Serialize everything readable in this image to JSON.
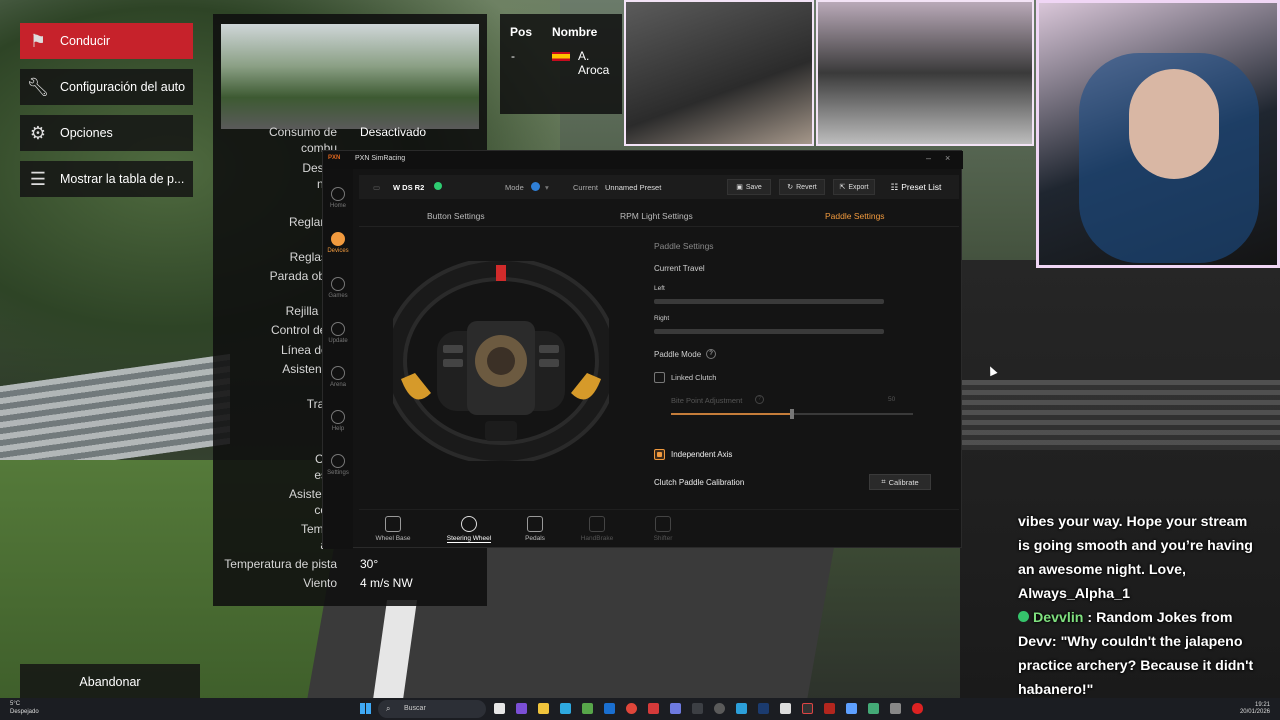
{
  "game_menu": {
    "items": [
      {
        "label": "Conducir",
        "icon": "checkered-flag-icon"
      },
      {
        "label": "Configuración del auto",
        "icon": "wrench-icon"
      },
      {
        "label": "Opciones",
        "icon": "gear-icon"
      },
      {
        "label": "Mostrar la tabla de p...",
        "icon": "list-icon"
      }
    ],
    "abandon_label": "Abandonar"
  },
  "session_settings": {
    "rows": [
      {
        "label": "Consumo de",
        "value": "Desactivado"
      },
      {
        "label": "combu",
        "value": ""
      },
      {
        "label": "Desga",
        "value": ""
      },
      {
        "label": "neu",
        "value": ""
      },
      {
        "label": "Reglame",
        "value": ""
      },
      {
        "label": "ba",
        "value": ""
      },
      {
        "label": "Reglas d",
        "value": ""
      },
      {
        "label": "Parada oblig",
        "value": ""
      },
      {
        "label": "Rejilla inv",
        "value": ""
      },
      {
        "label": "Control de tr",
        "value": ""
      },
      {
        "label": "Línea de c",
        "value": ""
      },
      {
        "label": "Asistencia",
        "value": ""
      },
      {
        "label": "Trans",
        "value": ""
      },
      {
        "label": "Fr",
        "value": ""
      },
      {
        "label": "Con",
        "value": ""
      },
      {
        "label": "esta",
        "value": ""
      },
      {
        "label": "Asistenci",
        "value": ""
      },
      {
        "label": "cont",
        "value": ""
      },
      {
        "label": "Tempe",
        "value": ""
      },
      {
        "label": "am",
        "value": ""
      },
      {
        "label": "Temperatura de pista",
        "value": "30°"
      },
      {
        "label": "Viento",
        "value": "4 m/s NW"
      }
    ]
  },
  "standings": {
    "headers": [
      "Pos",
      "Nombre"
    ],
    "rows": [
      {
        "pos": "-",
        "flag": "spain-flag-icon",
        "name": "A. Aroca"
      }
    ]
  },
  "pxn": {
    "window_title": "PXN SimRacing",
    "logo": "PXN",
    "sidebar": [
      {
        "label": "Home",
        "icon": "home-icon"
      },
      {
        "label": "Devices",
        "icon": "devices-icon",
        "active": true
      },
      {
        "label": "Games",
        "icon": "games-icon"
      },
      {
        "label": "Update",
        "icon": "update-icon"
      },
      {
        "label": "Arena",
        "icon": "arena-icon"
      },
      {
        "label": "Help",
        "icon": "help-icon"
      },
      {
        "label": "Settings",
        "icon": "settings-icon"
      }
    ],
    "device_name": "W DS R2",
    "mode_label": "Mode",
    "current_label": "Current",
    "preset_name": "Unnamed Preset",
    "buttons": {
      "save": "Save",
      "revert": "Revert",
      "export": "Export",
      "preset_list": "Preset List"
    },
    "tabs": [
      "Button Settings",
      "RPM Light Settings",
      "Paddle Settings"
    ],
    "active_tab": "Paddle Settings",
    "paddle": {
      "section_title": "Paddle Settings",
      "current_travel_label": "Current Travel",
      "left_label": "Left",
      "right_label": "Right",
      "mode_label": "Paddle Mode",
      "linked_clutch_label": "Linked Clutch",
      "linked_clutch_checked": false,
      "bite_point_label": "Bite Point Adjustment",
      "bite_point_value": "50",
      "independent_axis_label": "Independent Axis",
      "independent_axis_checked": true,
      "clutch_calibration_label": "Clutch Paddle Calibration",
      "calibrate_label": "Calibrate"
    },
    "bottom_nav": [
      {
        "label": "Wheel Base",
        "state": "normal"
      },
      {
        "label": "Steering Wheel",
        "state": "active"
      },
      {
        "label": "Pedals",
        "state": "normal"
      },
      {
        "label": "HandBrake",
        "state": "dim"
      },
      {
        "label": "Shifter",
        "state": "dim"
      }
    ],
    "accent_color": "#f19a3e"
  },
  "chat": {
    "line1": "vibes your way. Hope your stream",
    "line2": "is going smooth and you’re having",
    "line3": "an awesome night. Love,",
    "line4": "Always_Alpha_1",
    "user": "Devvlin",
    "sep": " : ",
    "msg_a": "Random Jokes from",
    "msg_b": "Devv: \"Why couldn't the jalapeno",
    "msg_c": "practice archery? Because it didn't",
    "msg_d": "habanero!\""
  },
  "taskbar": {
    "weather_temp": "5°C",
    "weather_desc": "Despejado",
    "search_placeholder": "Buscar",
    "time": "19:21",
    "date": "20/01/2026"
  }
}
